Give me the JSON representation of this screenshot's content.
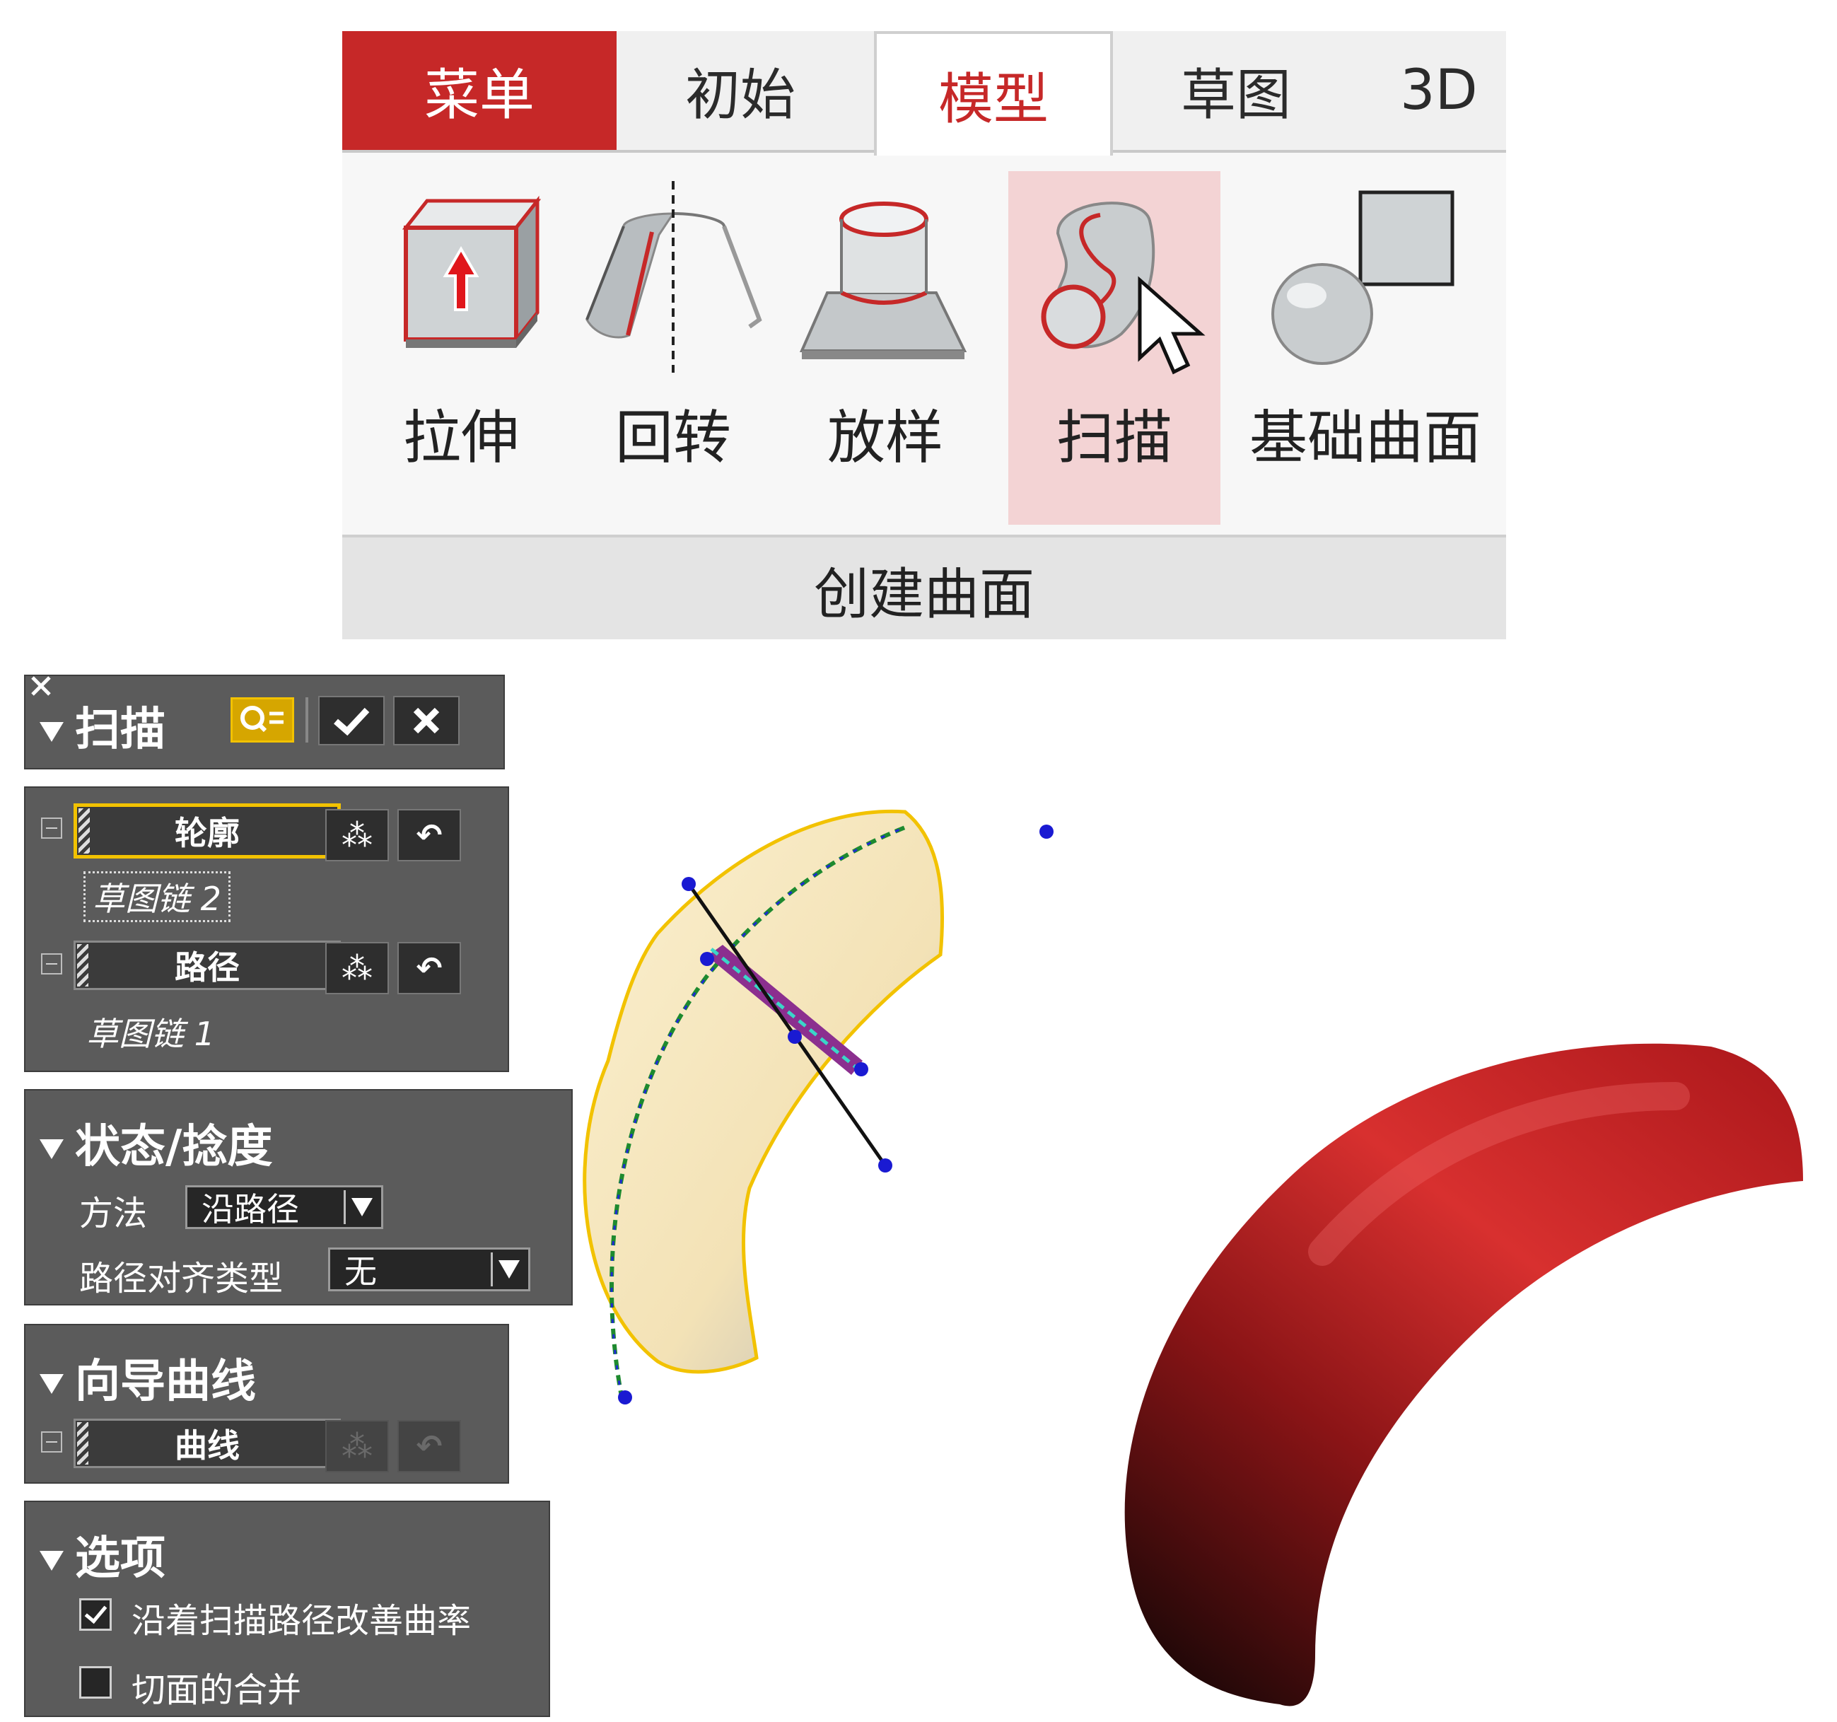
{
  "ribbon": {
    "tabs": [
      {
        "label": "菜单",
        "state": "menu"
      },
      {
        "label": "初始",
        "state": "normal"
      },
      {
        "label": "模型",
        "state": "active"
      },
      {
        "label": "草图",
        "state": "normal"
      },
      {
        "label": "3D",
        "state": "normal"
      }
    ],
    "tools": [
      {
        "label": "拉伸",
        "icon": "extrude-icon"
      },
      {
        "label": "回转",
        "icon": "revolve-icon"
      },
      {
        "label": "放样",
        "icon": "loft-icon"
      },
      {
        "label": "扫描",
        "icon": "sweep-icon",
        "highlighted": true
      },
      {
        "label": "基础曲面",
        "icon": "basic-surface-icon"
      }
    ],
    "group_label": "创建曲面"
  },
  "sweep_panel": {
    "title": "扫描",
    "profile": {
      "button": "轮廓",
      "value": "草图链 2"
    },
    "path": {
      "button": "路径",
      "value": "草图链 1"
    }
  },
  "state_panel": {
    "title": "状态/捻度",
    "method_label": "方法",
    "method_value": "沿路径",
    "align_label": "路径对齐类型",
    "align_value": "无"
  },
  "guide_panel": {
    "title": "向导曲线",
    "curve_button": "曲线"
  },
  "options_panel": {
    "title": "选项",
    "options": [
      {
        "label": "沿着扫描路径改善曲率",
        "checked": true
      },
      {
        "label": "切面的合并",
        "checked": false
      }
    ]
  },
  "colors": {
    "accent_red": "#c62828",
    "highlight": "#f3d3d4",
    "panel_bg": "#5b5b5b",
    "active_field_border": "#f2c200",
    "surface_preview": "#f5e6be",
    "result_surface": "#b0171a"
  }
}
